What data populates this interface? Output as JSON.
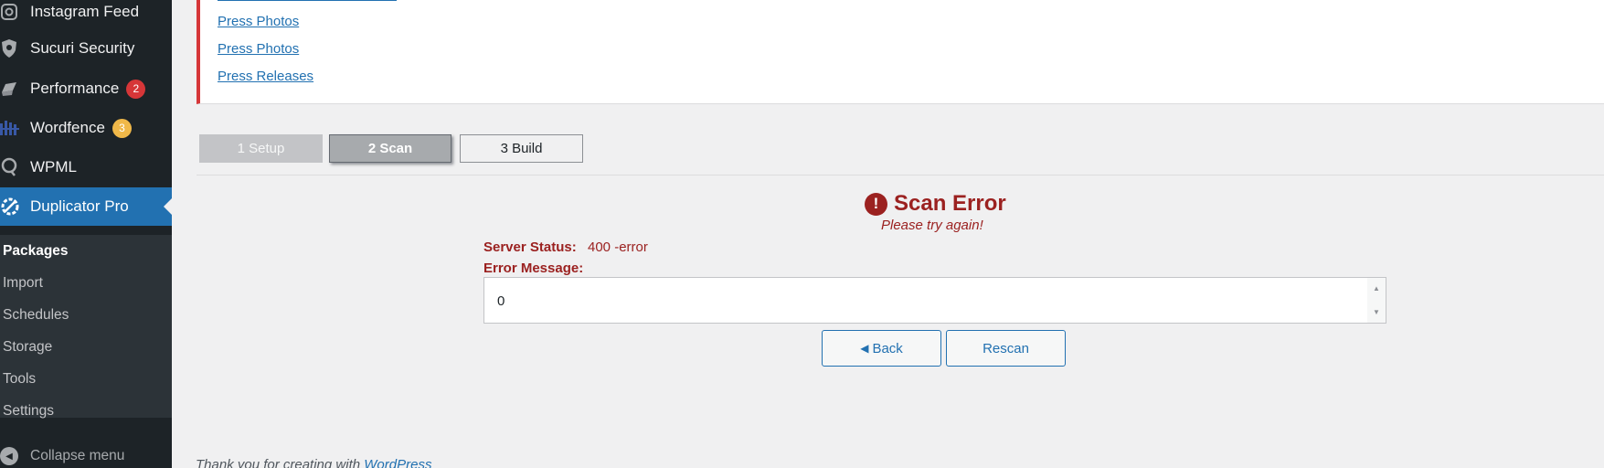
{
  "sidebar": {
    "menu": [
      {
        "label": "Instagram Feed",
        "icon": "instagram-icon"
      },
      {
        "label": "Sucuri Security",
        "icon": "shield-icon"
      },
      {
        "label": "Performance",
        "icon": "performance-icon",
        "badge": "2"
      },
      {
        "label": "Wordfence",
        "icon": "wordfence-icon",
        "badge": "3"
      },
      {
        "label": "WPML",
        "icon": "wpml-icon"
      },
      {
        "label": "Duplicator Pro",
        "icon": "duplicator-icon"
      }
    ],
    "submenu": [
      "Packages",
      "Import",
      "Schedules",
      "Storage",
      "Tools",
      "Settings"
    ],
    "collapse_label": "Collapse menu"
  },
  "links": [
    "Press Photos",
    "Press Photos",
    "Press Releases"
  ],
  "steps": [
    "1 Setup",
    "2 Scan",
    "3 Build"
  ],
  "error": {
    "title": "Scan Error",
    "subtitle": "Please try again!",
    "server_status_label": "Server Status:",
    "server_status_value": "400 -error",
    "message_label": "Error Message:",
    "message_value": "0"
  },
  "buttons": {
    "back": "Back",
    "rescan": "Rescan"
  },
  "footer": {
    "text": "Thank you for creating with ",
    "link": "WordPress"
  },
  "colors": {
    "accent": "#2271b1",
    "error": "#9b2120",
    "sidebar": "#1d2327"
  }
}
